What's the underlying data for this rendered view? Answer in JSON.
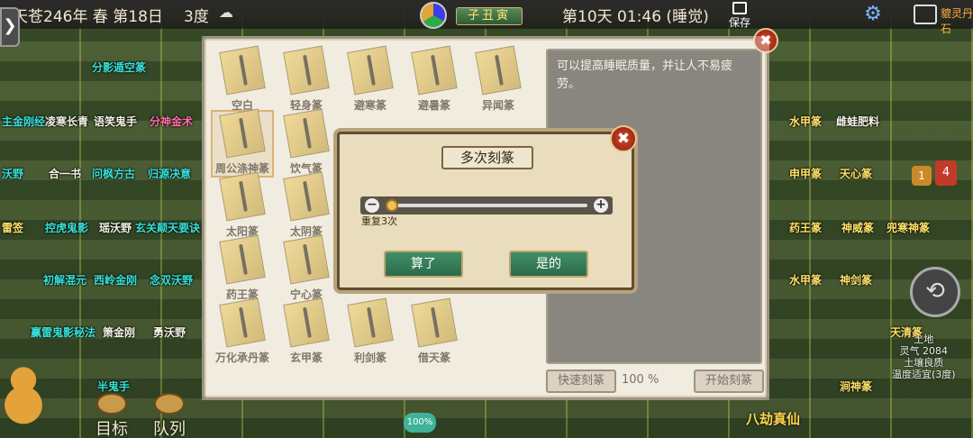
{
  "hud": {
    "date": "天苍246年 春 第18日",
    "temperature": "3度",
    "hour_label": "子丑寅",
    "day_time": "第10天 01:46 (睡觉)",
    "save_label": "保存",
    "left_tab_arrow": "❯",
    "gear_glyph": "⚙",
    "person_label": "貔灵丹石"
  },
  "field_labels": [
    {
      "text": "分影遁空篆",
      "color": "cyan"
    },
    {
      "text": "主金刚经",
      "color": "cyan"
    },
    {
      "text": "凌寒长青",
      "color": "white"
    },
    {
      "text": "语笑鬼手",
      "color": "white"
    },
    {
      "text": "分神金术",
      "color": "pink"
    },
    {
      "text": "沃野",
      "color": "cyan"
    },
    {
      "text": "合一书",
      "color": "white"
    },
    {
      "text": "问枫方古",
      "color": "cyan"
    },
    {
      "text": "归源决意",
      "color": "cyan"
    },
    {
      "text": "雷签",
      "color": "yellow"
    },
    {
      "text": "控虎鬼影",
      "color": "cyan"
    },
    {
      "text": "瑶沃野",
      "color": "white"
    },
    {
      "text": "玄关颠天要诀",
      "color": "cyan"
    },
    {
      "text": "初解混元",
      "color": "cyan"
    },
    {
      "text": "西岭金刚",
      "color": "cyan"
    },
    {
      "text": "念双沃野",
      "color": "cyan"
    },
    {
      "text": "赢雷鬼影秘法",
      "color": "cyan"
    },
    {
      "text": "箫金刚",
      "color": "white"
    },
    {
      "text": "勇沃野",
      "color": "white"
    },
    {
      "text": "半鬼手",
      "color": "cyan"
    },
    {
      "text": "水甲篆",
      "color": "yellow"
    },
    {
      "text": "雌蛙肥料",
      "color": "white"
    },
    {
      "text": "申甲篆",
      "color": "yellow"
    },
    {
      "text": "天心篆",
      "color": "yellow"
    },
    {
      "text": "药王篆",
      "color": "yellow"
    },
    {
      "text": "神威篆",
      "color": "yellow"
    },
    {
      "text": "兜寒神篆",
      "color": "yellow"
    },
    {
      "text": "水甲篆",
      "color": "yellow"
    },
    {
      "text": "神剑篆",
      "color": "yellow"
    },
    {
      "text": "天清篆",
      "color": "yellow"
    },
    {
      "text": "涧神篆",
      "color": "yellow"
    },
    {
      "text": "八劫真仙",
      "color": "orange"
    }
  ],
  "seals": [
    {
      "label": "空白",
      "selected": false
    },
    {
      "label": "轻身篆",
      "selected": false
    },
    {
      "label": "避寒篆",
      "selected": false
    },
    {
      "label": "避暑篆",
      "selected": false
    },
    {
      "label": "异闻篆",
      "selected": false
    },
    {
      "label": "周公涤神篆",
      "selected": true
    },
    {
      "label": "饮气篆",
      "selected": false
    },
    {
      "label": "太阳篆",
      "selected": false
    },
    {
      "label": "太阴篆",
      "selected": false
    },
    {
      "label": "药王篆",
      "selected": false
    },
    {
      "label": "宁心篆",
      "selected": false
    },
    {
      "label": "万化承丹篆",
      "selected": false
    },
    {
      "label": "玄甲篆",
      "selected": false
    },
    {
      "label": "利剑篆",
      "selected": false
    },
    {
      "label": "借天篆",
      "selected": false
    }
  ],
  "description": "可以提高睡眠质量，并让人不易疲劳。",
  "panel_close_glyph": "✖",
  "fast_label": "快速刻篆",
  "progress_percent": "100 %",
  "start_label": "开始刻篆",
  "dialog": {
    "title": "多次刻篆",
    "close_glyph": "✖",
    "minus_glyph": "−",
    "plus_glyph": "+",
    "repeat_label": "重复3次",
    "repeat_count": 3,
    "slider_fraction": 0.0,
    "cancel_label": "算了",
    "confirm_label": "是的"
  },
  "bottom": {
    "goal_label": "目标",
    "queue_label": "队列",
    "net_label": "100%",
    "title_text": "八劫真仙"
  },
  "badges": {
    "one": "1",
    "four": "4"
  },
  "back_glyph": "⟲",
  "tile_info": [
    "土地",
    "灵气 2084",
    "土壤良质",
    "温度适宜(3度)"
  ],
  "colors": {
    "accent_green": "#3f8f68",
    "close_red": "#c23a2a",
    "panel_bg": "#eae2cf"
  }
}
